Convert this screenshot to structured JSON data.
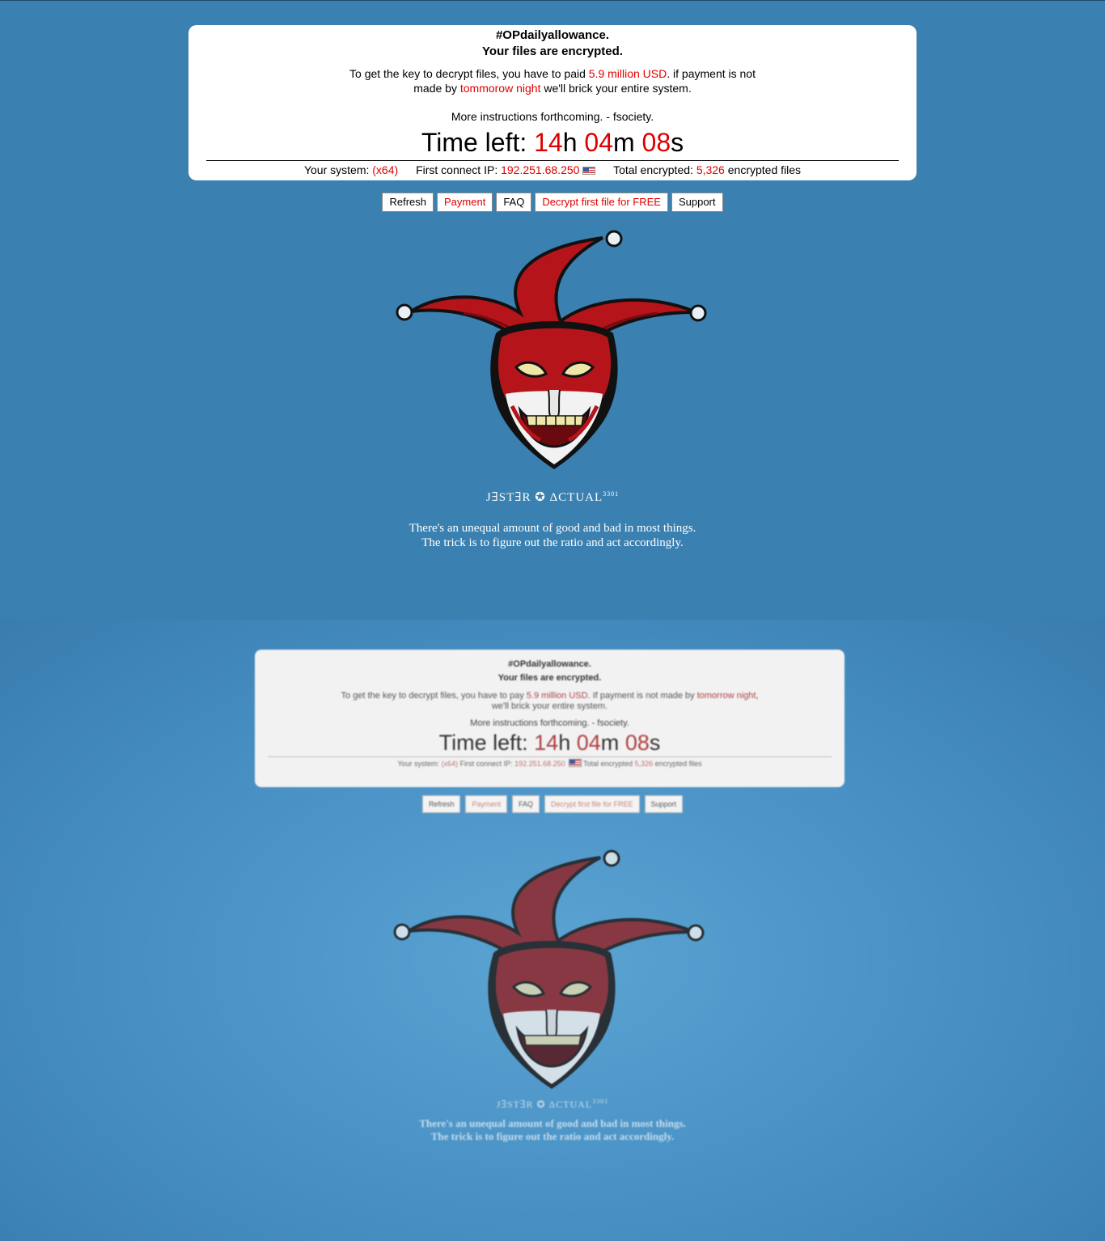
{
  "notice": {
    "title": "#OPdailyallowance.",
    "subtitle": "Your files are encrypted.",
    "msg_part1": "To get the key to decrypt files, you have to paid ",
    "amount": "5.9 million USD",
    "msg_part2": ". if payment is not made by ",
    "deadline": "tommorow night",
    "msg_part3": " we'll brick your entire system.",
    "more": "More instructions forthcoming. - fsociety."
  },
  "timer": {
    "label": "Time left: ",
    "hours": "14",
    "h": "h",
    "minutes": "04",
    "m": "m",
    "seconds": "08",
    "s": "s"
  },
  "system": {
    "sys_label": "Your system: ",
    "sys_value": "(x64)",
    "ip_label": "First connect IP: ",
    "ip_value": "192.251.68.250",
    "enc_label": "Total encrypted: ",
    "enc_value": "5,326",
    "enc_suffix": " encrypted files"
  },
  "buttons": {
    "refresh": "Refresh",
    "payment": "Payment",
    "faq": "FAQ",
    "decrypt": "Decrypt first file for FREE",
    "support": "Support"
  },
  "signature": {
    "brand": "J∃ST∃R ✪ ΔCTUAL",
    "brand_sup": "3301",
    "quote_line1": "There's an unequal amount of good and bad in most things.",
    "quote_line2": "The trick is to figure out the ratio and act accordingly."
  },
  "photo": {
    "title": "#OPdailyallowance.",
    "subtitle": "Your files are encrypted.",
    "msg_part1": "To get the key to decrypt files, you have to pay ",
    "amount": "5.9 million USD",
    "msg_part2": ". If payment is not made by ",
    "deadline": "tomorrow night",
    "msg_part3": ", we'll brick your entire system.",
    "more": "More instructions forthcoming. - fsociety.",
    "sys_label": "Your system: ",
    "sys_value": "(x64)",
    "ip_label": " First connect IP: ",
    "ip_value": "192.251.68.250",
    "enc_label": " Total encrypted ",
    "enc_value": "5,326",
    "enc_suffix": " encrypted files"
  },
  "colors": {
    "background": "#3a80b0",
    "accent_red": "#e00000",
    "jester_red": "#b5141b"
  }
}
